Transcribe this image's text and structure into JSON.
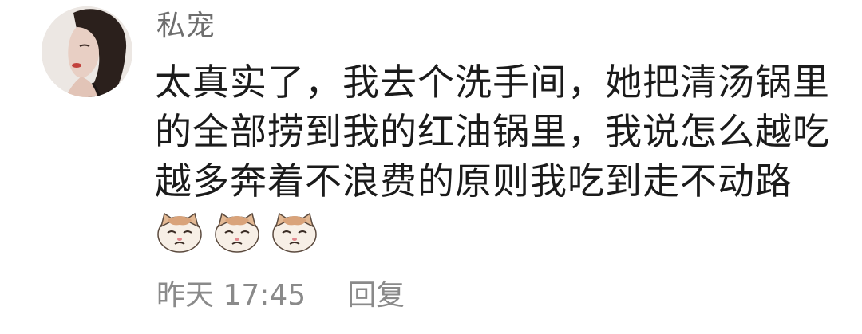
{
  "comment": {
    "username": "私宠",
    "text_lines": [
      "太真实了，我去个洗手间，她把清汤锅里",
      "的全部捞到我的红油锅里，我说怎么越吃",
      "越多奔着不浪费的原则我吃到走不动路"
    ],
    "emojis": [
      "cat-face-emoji",
      "cat-face-emoji",
      "cat-face-emoji"
    ],
    "timestamp": "昨天 17:45",
    "reply_label": "回复"
  },
  "colors": {
    "username": "#6e6e6e",
    "body_text": "#1b1b1b",
    "meta_text": "#8a8a8a"
  }
}
